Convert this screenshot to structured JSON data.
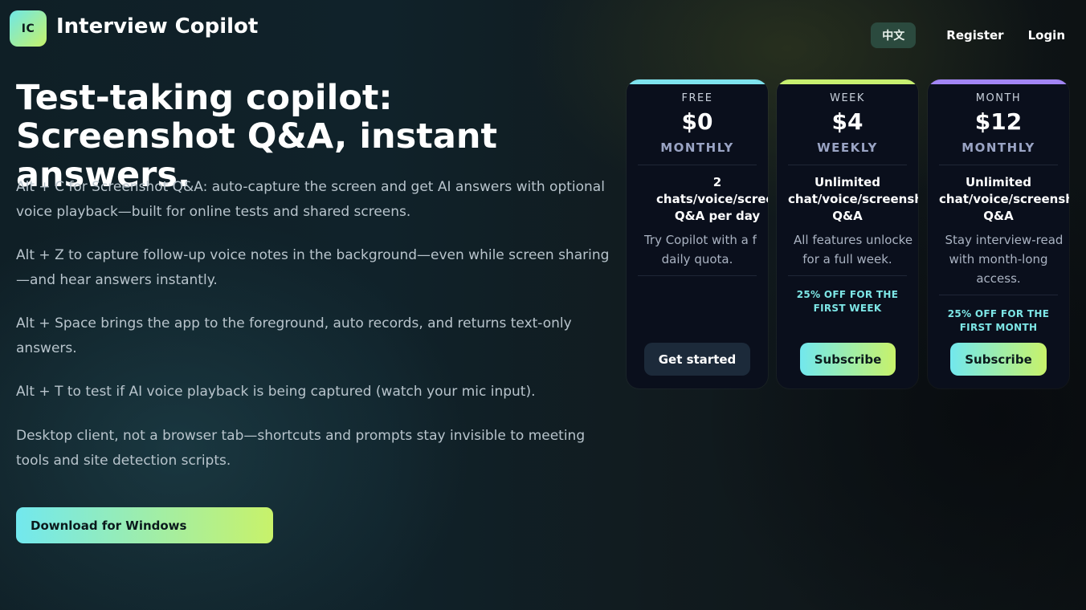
{
  "header": {
    "logo_text": "IC",
    "app_title": "Interview Copilot",
    "nav": {
      "lang_label": "中文",
      "register_label": "Register",
      "login_label": "Login"
    }
  },
  "hero": {
    "title": "Test-taking copilot: Screenshot Q&A, instant answers.",
    "paragraphs": [
      "Alt + C for Screenshot Q&A: auto-capture the screen and get AI answers with optional voice playback—built for online tests and shared screens.",
      "Alt + Z to capture follow-up voice notes in the background—even while screen sharing—and hear answers instantly.",
      "Alt + Space brings the app to the foreground, auto records, and returns text-only answers.",
      "Alt + T to test if AI voice playback is being captured (watch your mic input).",
      "Desktop client, not a browser tab—shortcuts and prompts stay invisible to meeting tools and site detection scripts."
    ],
    "download_label": "Download for Windows"
  },
  "plans": [
    {
      "name": "FREE",
      "price": "$0",
      "period": "MONTHLY",
      "feature_lines": [
        "2",
        "chats/voice/screens",
        "Q&A per day"
      ],
      "desc_lines": [
        "Try Copilot with a fr",
        "daily quota."
      ],
      "promo_lines": [],
      "button_label": "Get started",
      "accent_color": "#7ee3ee"
    },
    {
      "name": "WEEK",
      "price": "$4",
      "period": "WEEKLY",
      "feature_lines": [
        "Unlimited",
        "chat/voice/screensh",
        "Q&A"
      ],
      "desc_lines": [
        "All features unlocke",
        "for a full week."
      ],
      "promo_lines": [
        "25% OFF FOR THE",
        "FIRST WEEK"
      ],
      "button_label": "Subscribe",
      "accent_color": "#c8f070"
    },
    {
      "name": "MONTH",
      "price": "$12",
      "period": "MONTHLY",
      "feature_lines": [
        "Unlimited",
        "chat/voice/screensh",
        "Q&A"
      ],
      "desc_lines": [
        "Stay interview-read",
        "with month-long",
        "access."
      ],
      "promo_lines": [
        "25% OFF FOR THE",
        "FIRST MONTH"
      ],
      "button_label": "Subscribe",
      "accent_color": "#a285f5"
    }
  ],
  "colors": {
    "brand_gradient_start": "#72e8ee",
    "brand_gradient_end": "#c8f26a",
    "card_background": "#0a0f1c"
  }
}
